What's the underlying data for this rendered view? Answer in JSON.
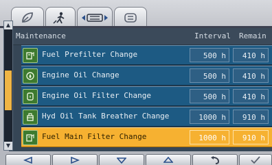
{
  "tabs": [
    {
      "icon": "leaf-icon"
    },
    {
      "icon": "person-icon"
    },
    {
      "icon": "maintenance-icon",
      "active": true
    },
    {
      "icon": "list-icon"
    }
  ],
  "header": {
    "maintenance": "Maintenance",
    "interval": "Interval",
    "remain": "Remain"
  },
  "rows": [
    {
      "name": "Fuel Prefilter Change",
      "interval": "500 h",
      "remain": "410 h",
      "icon": "fuel-filter-icon"
    },
    {
      "name": "Engine Oil Change",
      "interval": "500 h",
      "remain": "410 h",
      "icon": "oil-drop-icon"
    },
    {
      "name": "Engine Oil Filter Change",
      "interval": "500 h",
      "remain": "410 h",
      "icon": "oil-filter-icon"
    },
    {
      "name": "Hyd Oil Tank Breather Change",
      "interval": "1000 h",
      "remain": "910 h",
      "icon": "breather-icon"
    },
    {
      "name": "Fuel Main Filter Change",
      "interval": "1000 h",
      "remain": "910 h",
      "icon": "fuel-filter-icon",
      "selected": true
    }
  ],
  "buttons": [
    "left",
    "right",
    "down",
    "up",
    "back",
    "confirm"
  ],
  "colors": {
    "selected": "#f6b131",
    "row": "#1d5a83"
  }
}
